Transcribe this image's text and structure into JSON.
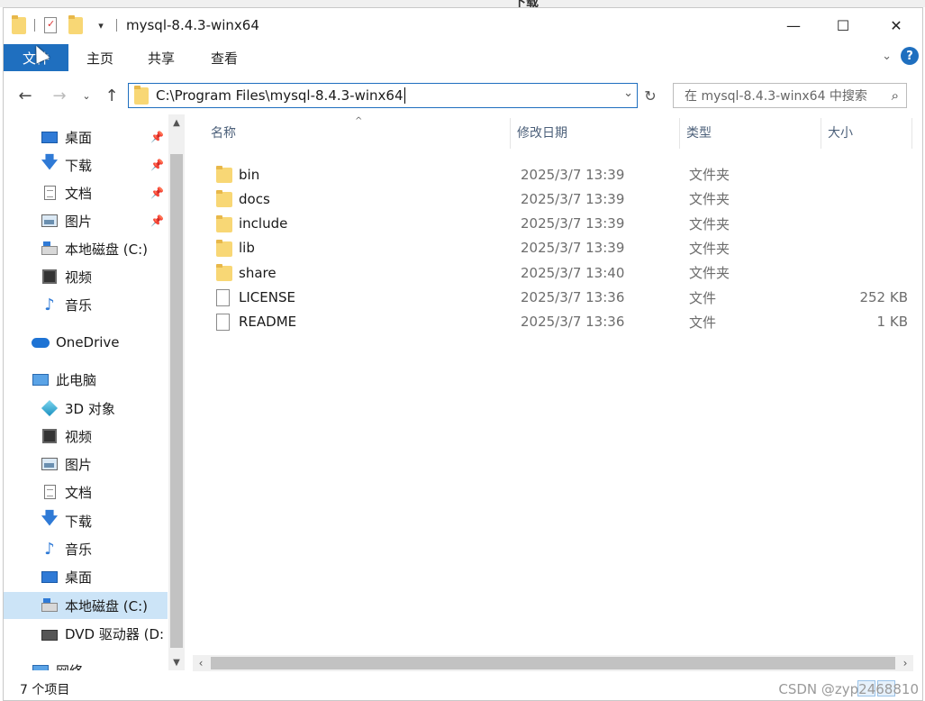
{
  "window": {
    "title": "mysql-8.4.3-winx64",
    "controls": {
      "minimize": "—",
      "maximize": "☐",
      "close": "✕"
    }
  },
  "ribbon": {
    "tabs": [
      "文件",
      "主页",
      "共享",
      "查看"
    ],
    "expand_icon": "chevron-down-icon",
    "help_label": "?"
  },
  "nav": {
    "address": "C:\\Program Files\\mysql-8.4.3-winx64",
    "search_placeholder": "在 mysql-8.4.3-winx64 中搜索"
  },
  "sidebar": {
    "items": [
      {
        "label": "桌面",
        "icon": "desktop-icon",
        "pinned": true
      },
      {
        "label": "下载",
        "icon": "download-icon",
        "pinned": true
      },
      {
        "label": "文档",
        "icon": "document-icon",
        "pinned": true
      },
      {
        "label": "图片",
        "icon": "picture-icon",
        "pinned": true
      },
      {
        "label": "本地磁盘 (C:)",
        "icon": "drive-icon",
        "pinned": false
      },
      {
        "label": "视频",
        "icon": "video-icon",
        "pinned": false
      },
      {
        "label": "音乐",
        "icon": "music-icon",
        "pinned": false
      },
      {
        "label": "OneDrive",
        "icon": "onedrive-icon",
        "pinned": false
      },
      {
        "label": "此电脑",
        "icon": "computer-icon",
        "pinned": false
      },
      {
        "label": "3D 对象",
        "icon": "3d-objects-icon",
        "pinned": false
      },
      {
        "label": "视频",
        "icon": "video-icon",
        "pinned": false
      },
      {
        "label": "图片",
        "icon": "picture-icon",
        "pinned": false
      },
      {
        "label": "文档",
        "icon": "document-icon",
        "pinned": false
      },
      {
        "label": "下载",
        "icon": "download-icon",
        "pinned": false
      },
      {
        "label": "音乐",
        "icon": "music-icon",
        "pinned": false
      },
      {
        "label": "桌面",
        "icon": "desktop-icon",
        "pinned": false
      },
      {
        "label": "本地磁盘 (C:)",
        "icon": "drive-icon",
        "pinned": false,
        "selected": true
      },
      {
        "label": "DVD 驱动器 (D:",
        "icon": "dvd-icon",
        "pinned": false
      },
      {
        "label": "网络",
        "icon": "network-icon",
        "pinned": false
      }
    ]
  },
  "columns": {
    "name": "名称",
    "date": "修改日期",
    "type": "类型",
    "size": "大小"
  },
  "files": [
    {
      "name": "bin",
      "date": "2025/3/7 13:39",
      "type": "文件夹",
      "size": "",
      "kind": "folder"
    },
    {
      "name": "docs",
      "date": "2025/3/7 13:39",
      "type": "文件夹",
      "size": "",
      "kind": "folder"
    },
    {
      "name": "include",
      "date": "2025/3/7 13:39",
      "type": "文件夹",
      "size": "",
      "kind": "folder"
    },
    {
      "name": "lib",
      "date": "2025/3/7 13:39",
      "type": "文件夹",
      "size": "",
      "kind": "folder"
    },
    {
      "name": "share",
      "date": "2025/3/7 13:40",
      "type": "文件夹",
      "size": "",
      "kind": "folder"
    },
    {
      "name": "LICENSE",
      "date": "2025/3/7 13:36",
      "type": "文件",
      "size": "252 KB",
      "kind": "file"
    },
    {
      "name": "README",
      "date": "2025/3/7 13:36",
      "type": "文件",
      "size": "1 KB",
      "kind": "file"
    }
  ],
  "status": {
    "item_count": "7 个项目",
    "watermark": "CSDN @zyp2468810"
  },
  "colors": {
    "accent": "#1f6fbf",
    "selected_bg": "#cce4f7",
    "folder": "#f8d775"
  }
}
